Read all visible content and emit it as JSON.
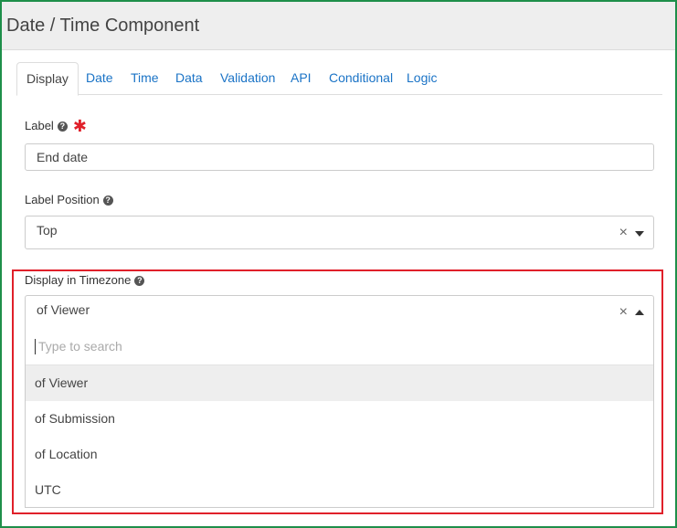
{
  "header": {
    "title": "Date / Time Component"
  },
  "tabs": [
    {
      "label": "Display"
    },
    {
      "label": "Date"
    },
    {
      "label": "Time"
    },
    {
      "label": "Data"
    },
    {
      "label": "Validation"
    },
    {
      "label": "API"
    },
    {
      "label": "Conditional"
    },
    {
      "label": "Logic"
    }
  ],
  "fields": {
    "label": {
      "label": "Label",
      "value": "End date",
      "required_mark": "✱"
    },
    "label_position": {
      "label": "Label Position",
      "value": "Top"
    },
    "timezone": {
      "label": "Display in Timezone",
      "value": "of Viewer",
      "search_placeholder": "Type to search",
      "options": [
        {
          "label": "of Viewer"
        },
        {
          "label": "of Submission"
        },
        {
          "label": "of Location"
        },
        {
          "label": "UTC"
        }
      ]
    }
  },
  "glyphs": {
    "help": "?",
    "clear": "×"
  },
  "colors": {
    "link": "#1a73c6",
    "required": "#e0202a",
    "highlight_border": "#e0202a",
    "frame_border": "#1e8f4a"
  }
}
